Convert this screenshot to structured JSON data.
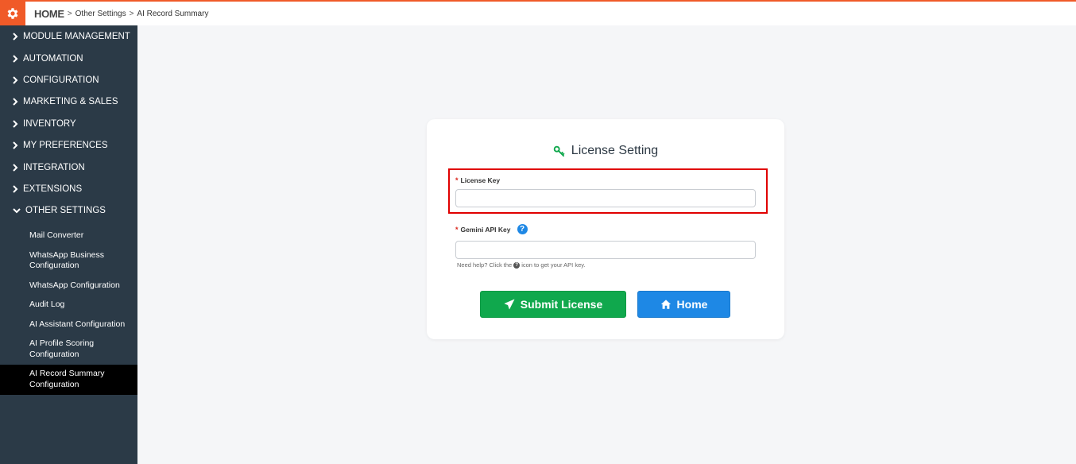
{
  "header": {
    "breadcrumb": [
      "HOME",
      "Other Settings",
      "AI Record Summary"
    ],
    "separator": ">"
  },
  "sidebar": {
    "items": [
      {
        "label": "MODULE MANAGEMENT"
      },
      {
        "label": "AUTOMATION"
      },
      {
        "label": "CONFIGURATION"
      },
      {
        "label": "MARKETING & SALES"
      },
      {
        "label": "INVENTORY"
      },
      {
        "label": "MY PREFERENCES"
      },
      {
        "label": "INTEGRATION"
      },
      {
        "label": "EXTENSIONS"
      },
      {
        "label": "OTHER SETTINGS"
      }
    ],
    "subitems": [
      {
        "label": "Mail Converter"
      },
      {
        "label": "WhatsApp Business Configuration"
      },
      {
        "label": "WhatsApp Configuration"
      },
      {
        "label": "Audit Log"
      },
      {
        "label": "AI Assistant Configuration"
      },
      {
        "label": "AI Profile Scoring Configuration"
      },
      {
        "label": "AI Record Summary Configuration"
      }
    ]
  },
  "card": {
    "title": "License Setting",
    "license_key": {
      "label": "License Key",
      "value": "",
      "required_mark": "*"
    },
    "gemini_key": {
      "label": "Gemini API Key",
      "value": "",
      "required_mark": "*",
      "help_glyph": "?"
    },
    "hint": {
      "prefix": "Need help? Click the",
      "suffix": "icon to get your API key."
    },
    "submit_label": "Submit License",
    "home_label": "Home"
  },
  "colors": {
    "accent": "#f05a28",
    "sidebar_bg": "#2b3a47",
    "submit": "#10a84d",
    "home": "#1e88e5",
    "highlight": "#e00000"
  },
  "icons": {
    "app": "gear-icon",
    "nav": "chevron-right-icon",
    "nav_open": "chevron-down-icon",
    "title": "key-icon",
    "submit": "paper-plane-icon",
    "home": "home-icon"
  }
}
